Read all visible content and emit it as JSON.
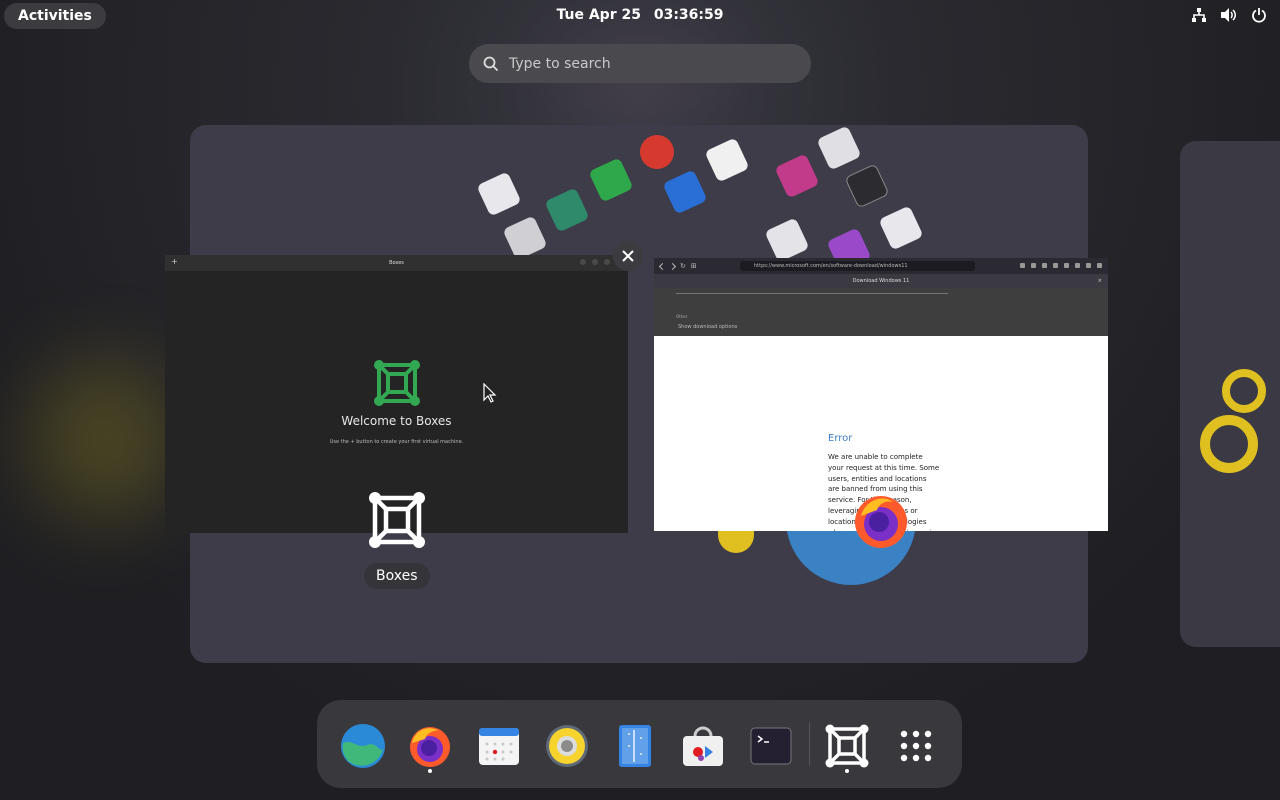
{
  "topbar": {
    "activities_label": "Activities",
    "date": "Tue Apr 25",
    "time": "03:36:59",
    "tray_icons": [
      "network-icon",
      "volume-icon",
      "power-icon"
    ]
  },
  "search": {
    "placeholder": "Type to search"
  },
  "windows": {
    "boxes": {
      "title": "Boxes",
      "welcome": "Welcome to Boxes",
      "subtitle": "Use the + button to create your first virtual machine.",
      "app_label": "Boxes"
    },
    "firefox": {
      "url": "https://www.microsoft.com/en/software-download/windows11",
      "tab_title": "Download Windows 11",
      "section_label": "Other",
      "show_downloads": "Show download options",
      "error_title": "Error",
      "error_body": "We are unable to complete your request at this time. Some users, entities and locations are banned from using this service. For this reason, leveraging anonymous or location hiding technologies when connecting to this service is"
    }
  },
  "dash": {
    "items": [
      {
        "name": "web-browser-icon",
        "running": false
      },
      {
        "name": "firefox-icon",
        "running": true
      },
      {
        "name": "calendar-icon",
        "running": false
      },
      {
        "name": "rhythmbox-icon",
        "running": false
      },
      {
        "name": "text-editor-icon",
        "running": false
      },
      {
        "name": "software-icon",
        "running": false
      },
      {
        "name": "terminal-icon",
        "running": false
      },
      {
        "name": "boxes-icon",
        "running": true
      },
      {
        "name": "app-grid-icon",
        "running": false
      }
    ]
  },
  "colors": {
    "workspace_bg": "#3d3c48",
    "boxes_green": "#33a853",
    "error_blue": "#3d7fc4"
  }
}
